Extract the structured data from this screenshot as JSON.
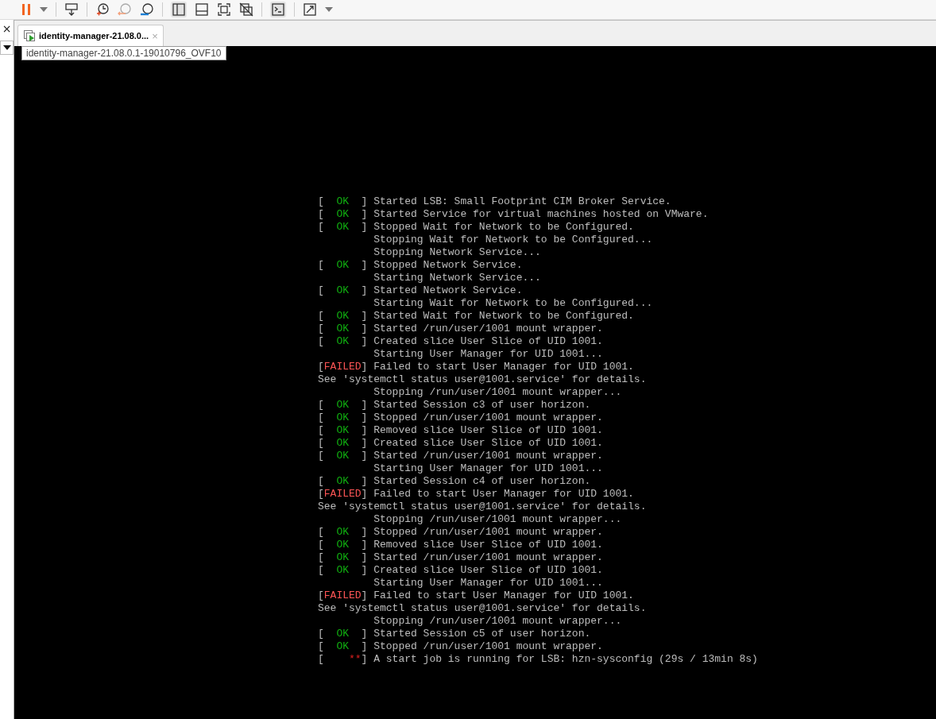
{
  "tab": {
    "title": "identity-manager-21.08.0...",
    "close": "×",
    "selected": true
  },
  "tooltip": {
    "text": "identity-manager-21.08.0.1-19010796_OVF10"
  },
  "side_panel": {
    "close": "×"
  },
  "console": [
    {
      "kind": "ok",
      "left": "[",
      "status": "OK",
      "right": "]",
      "text": "Started LSB: Small Footprint CIM Broker Service."
    },
    {
      "kind": "ok",
      "left": "[",
      "status": "OK",
      "right": "]",
      "text": "Started Service for virtual machines hosted on VMware."
    },
    {
      "kind": "ok",
      "left": "[",
      "status": "OK",
      "right": "]",
      "text": "Stopped Wait for Network to be Configured."
    },
    {
      "kind": "plain",
      "text": "Stopping Wait for Network to be Configured..."
    },
    {
      "kind": "plain",
      "text": "Stopping Network Service..."
    },
    {
      "kind": "ok",
      "left": "[",
      "status": "OK",
      "right": "]",
      "text": "Stopped Network Service."
    },
    {
      "kind": "plain",
      "text": "Starting Network Service..."
    },
    {
      "kind": "ok",
      "left": "[",
      "status": "OK",
      "right": "]",
      "text": "Started Network Service."
    },
    {
      "kind": "plain",
      "text": "Starting Wait for Network to be Configured..."
    },
    {
      "kind": "ok",
      "left": "[",
      "status": "OK",
      "right": "]",
      "text": "Started Wait for Network to be Configured."
    },
    {
      "kind": "ok",
      "left": "[",
      "status": "OK",
      "right": "]",
      "text": "Started /run/user/1001 mount wrapper."
    },
    {
      "kind": "ok",
      "left": "[",
      "status": "OK",
      "right": "]",
      "text": "Created slice User Slice of UID 1001."
    },
    {
      "kind": "plain",
      "text": "Starting User Manager for UID 1001..."
    },
    {
      "kind": "failed",
      "left": "[",
      "status": "FAILED",
      "right": "]",
      "text": "Failed to start User Manager for UID 1001."
    },
    {
      "kind": "note",
      "text": "See 'systemctl status user@1001.service' for details."
    },
    {
      "kind": "plain",
      "text": "Stopping /run/user/1001 mount wrapper..."
    },
    {
      "kind": "ok",
      "left": "[",
      "status": "OK",
      "right": "]",
      "text": "Started Session c3 of user horizon."
    },
    {
      "kind": "ok",
      "left": "[",
      "status": "OK",
      "right": "]",
      "text": "Stopped /run/user/1001 mount wrapper."
    },
    {
      "kind": "ok",
      "left": "[",
      "status": "OK",
      "right": "]",
      "text": "Removed slice User Slice of UID 1001."
    },
    {
      "kind": "ok",
      "left": "[",
      "status": "OK",
      "right": "]",
      "text": "Created slice User Slice of UID 1001."
    },
    {
      "kind": "ok",
      "left": "[",
      "status": "OK",
      "right": "]",
      "text": "Started /run/user/1001 mount wrapper."
    },
    {
      "kind": "plain",
      "text": "Starting User Manager for UID 1001..."
    },
    {
      "kind": "ok",
      "left": "[",
      "status": "OK",
      "right": "]",
      "text": "Started Session c4 of user horizon."
    },
    {
      "kind": "failed",
      "left": "[",
      "status": "FAILED",
      "right": "]",
      "text": "Failed to start User Manager for UID 1001."
    },
    {
      "kind": "note",
      "text": "See 'systemctl status user@1001.service' for details."
    },
    {
      "kind": "plain",
      "text": "Stopping /run/user/1001 mount wrapper..."
    },
    {
      "kind": "ok",
      "left": "[",
      "status": "OK",
      "right": "]",
      "text": "Stopped /run/user/1001 mount wrapper."
    },
    {
      "kind": "ok",
      "left": "[",
      "status": "OK",
      "right": "]",
      "text": "Removed slice User Slice of UID 1001."
    },
    {
      "kind": "ok",
      "left": "[",
      "status": "OK",
      "right": "]",
      "text": "Started /run/user/1001 mount wrapper."
    },
    {
      "kind": "ok",
      "left": "[",
      "status": "OK",
      "right": "]",
      "text": "Created slice User Slice of UID 1001."
    },
    {
      "kind": "plain",
      "text": "Starting User Manager for UID 1001..."
    },
    {
      "kind": "failed",
      "left": "[",
      "status": "FAILED",
      "right": "]",
      "text": "Failed to start User Manager for UID 1001."
    },
    {
      "kind": "note",
      "text": "See 'systemctl status user@1001.service' for details."
    },
    {
      "kind": "plain",
      "text": "Stopping /run/user/1001 mount wrapper..."
    },
    {
      "kind": "ok",
      "left": "[",
      "status": "OK",
      "right": "]",
      "text": "Started Session c5 of user horizon."
    },
    {
      "kind": "ok",
      "left": "[",
      "status": "OK",
      "right": "]",
      "text": "Stopped /run/user/1001 mount wrapper."
    },
    {
      "kind": "job",
      "left": "[",
      "status": "**",
      "right": "]",
      "text": "A start job is running for LSB: hzn-sysconfig (29s / 13min 8s)"
    }
  ]
}
